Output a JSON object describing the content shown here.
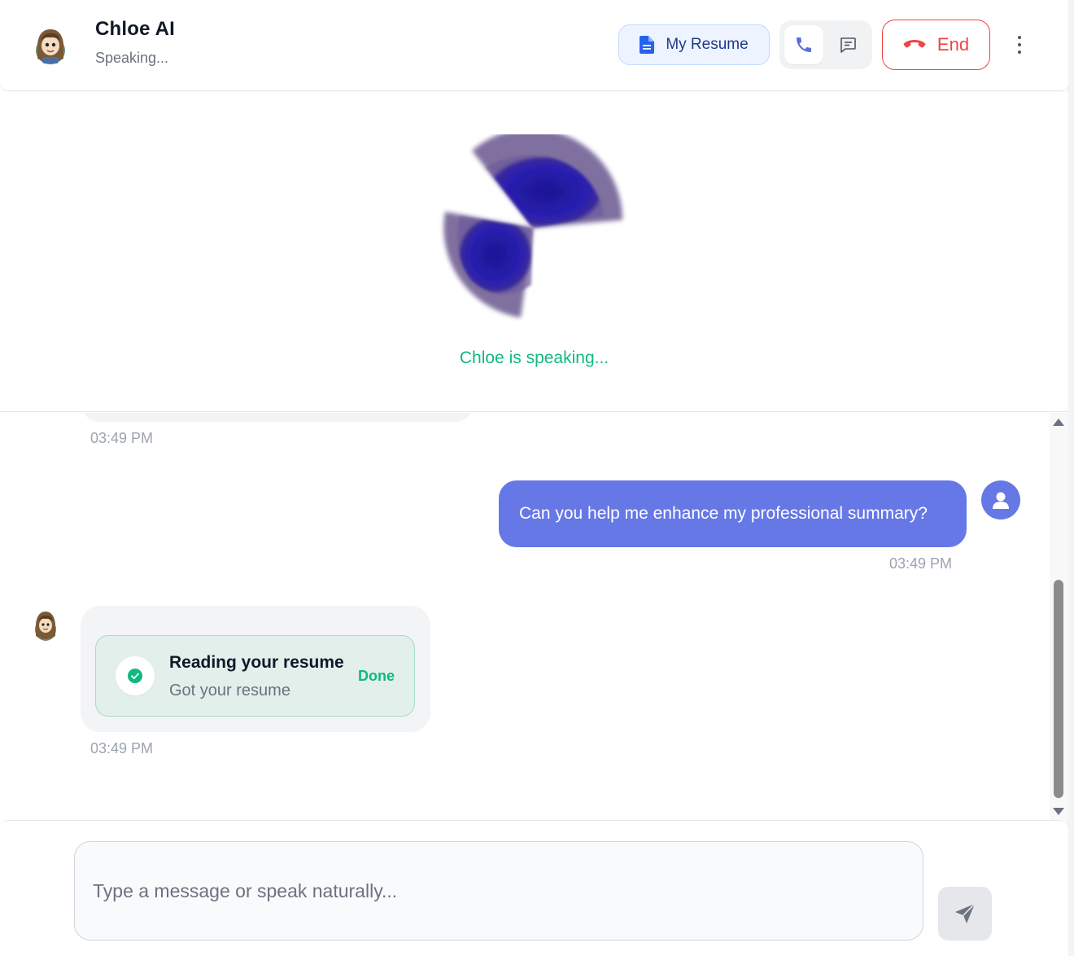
{
  "header": {
    "title": "Chloe AI",
    "status": "Speaking...",
    "resume_label": "My Resume",
    "end_label": "End",
    "avatar_icon": "cartoon-girl-avatar",
    "resume_icon": "document-icon",
    "phone_icon": "phone-icon",
    "chat_icon": "chat-bubble-icon",
    "end_icon": "hang-up-phone-icon",
    "more_icon": "vertical-dots-icon"
  },
  "voice": {
    "status_text": "Chloe is speaking..."
  },
  "chat": {
    "messages": [
      {
        "role": "assistant",
        "time": "03:49 PM"
      },
      {
        "role": "user",
        "text": "Can you help me enhance my professional summary?",
        "time": "03:49 PM"
      },
      {
        "role": "assistant",
        "tool": {
          "title": "Reading your resume",
          "subtitle": "Got your resume",
          "status": "Done"
        },
        "time": "03:49 PM"
      }
    ]
  },
  "composer": {
    "placeholder": "Type a message or speak naturally...",
    "value": "",
    "send_icon": "send-icon"
  },
  "colors": {
    "accent": "#6678e6",
    "success": "#10b981",
    "danger": "#ef4444",
    "orb": "#2a1fa8"
  }
}
